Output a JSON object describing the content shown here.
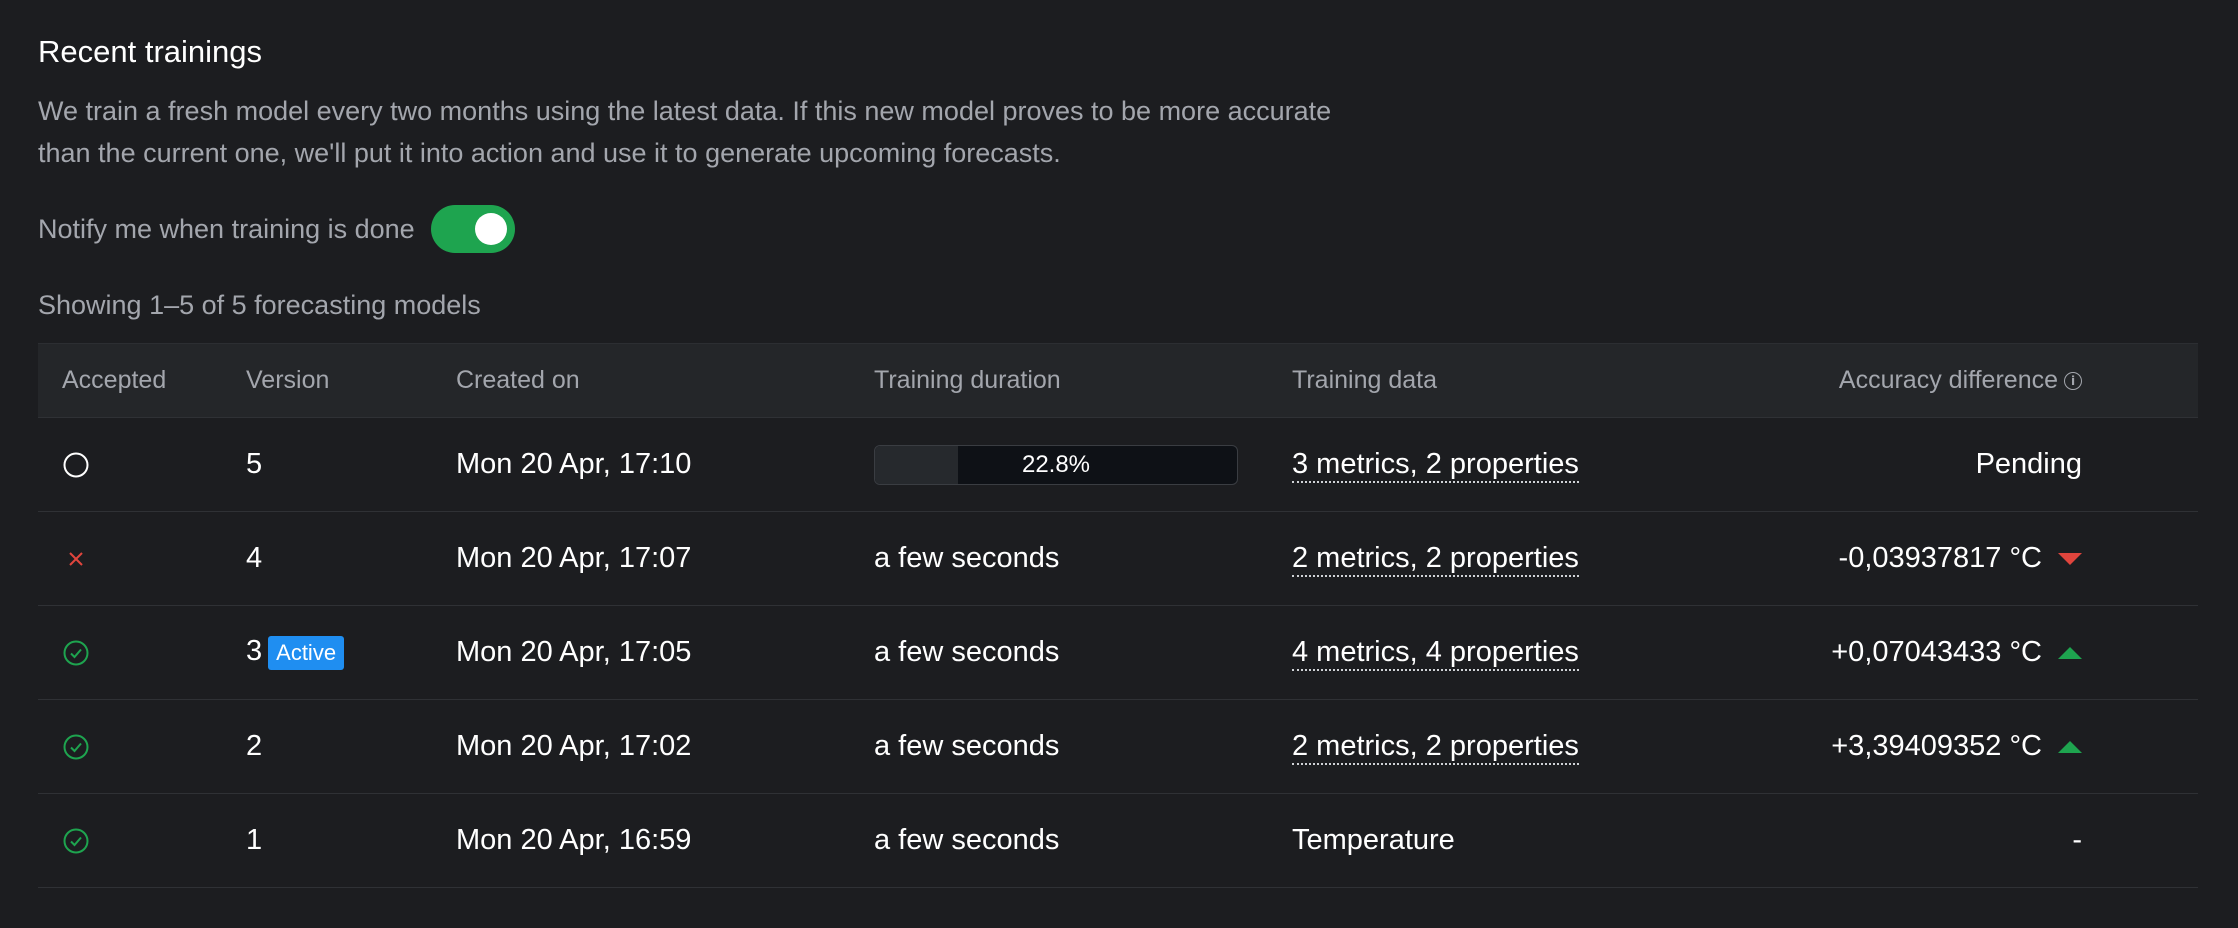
{
  "header": {
    "title": "Recent trainings",
    "description": "We train a fresh model every two months using the latest data. If this new model proves to be more accurate than the current one, we'll put it into action and use it to generate upcoming forecasts."
  },
  "notify": {
    "label": "Notify me when training is done",
    "enabled": true,
    "accent": "#1ea44f"
  },
  "showing_text": "Showing 1–5 of 5 forecasting models",
  "table": {
    "columns": {
      "accepted": "Accepted",
      "version": "Version",
      "created_on": "Created on",
      "training_duration": "Training duration",
      "training_data": "Training data",
      "accuracy_difference": "Accuracy difference"
    },
    "rows": [
      {
        "status_icon": "pending-circle-icon",
        "version": "5",
        "created_on": "Mon 20 Apr, 17:10",
        "progress_value": 0.228,
        "progress_label": "22.8%",
        "training_data": "3 metrics, 2 properties",
        "accuracy": "Pending"
      },
      {
        "status_icon": "cross-icon",
        "version": "4",
        "created_on": "Mon 20 Apr, 17:07",
        "duration": "a few seconds",
        "training_data": "2 metrics, 2 properties",
        "accuracy": "-0,03937817 °C",
        "trend": "down"
      },
      {
        "status_icon": "check-circle-icon",
        "version": "3",
        "badge": "Active",
        "created_on": "Mon 20 Apr, 17:05",
        "duration": "a few seconds",
        "training_data": "4 metrics, 4 properties",
        "accuracy": "+0,07043433 °C",
        "trend": "up"
      },
      {
        "status_icon": "check-circle-icon",
        "version": "2",
        "created_on": "Mon 20 Apr, 17:02",
        "duration": "a few seconds",
        "training_data": "2 metrics, 2 properties",
        "accuracy": "+3,39409352 °C",
        "trend": "up"
      },
      {
        "status_icon": "check-circle-icon",
        "version": "1",
        "created_on": "Mon 20 Apr, 16:59",
        "duration": "a few seconds",
        "training_data_plain": "Temperature",
        "accuracy": "-"
      }
    ]
  },
  "colors": {
    "background": "#1c1d20",
    "header_bg": "#242629",
    "muted_text": "#a3a6ad",
    "success": "#1ea44f",
    "danger": "#e0453d",
    "badge": "#1f8ef1"
  }
}
